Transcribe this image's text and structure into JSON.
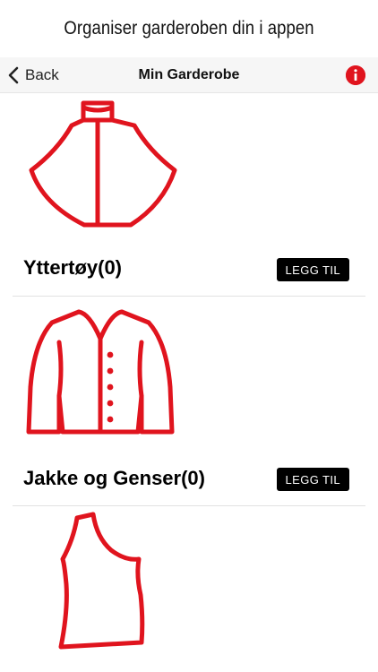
{
  "banner": {
    "text": "Organiser garderoben din i appen"
  },
  "navbar": {
    "back_label": "Back",
    "title": "Min Garderobe",
    "info_icon": "info-icon",
    "accent_color": "#e0141e"
  },
  "categories": [
    {
      "title": "Yttertøy(0)",
      "button_label": "LEGG TIL",
      "icon": "cape-icon"
    },
    {
      "title": "Jakke og Genser(0)",
      "button_label": "LEGG TIL",
      "icon": "cardigan-icon"
    },
    {
      "title": "",
      "button_label": "",
      "icon": "one-shoulder-top-icon"
    }
  ],
  "colors": {
    "icon_stroke": "#e0141e",
    "button_bg": "#000000",
    "button_text": "#ffffff"
  }
}
